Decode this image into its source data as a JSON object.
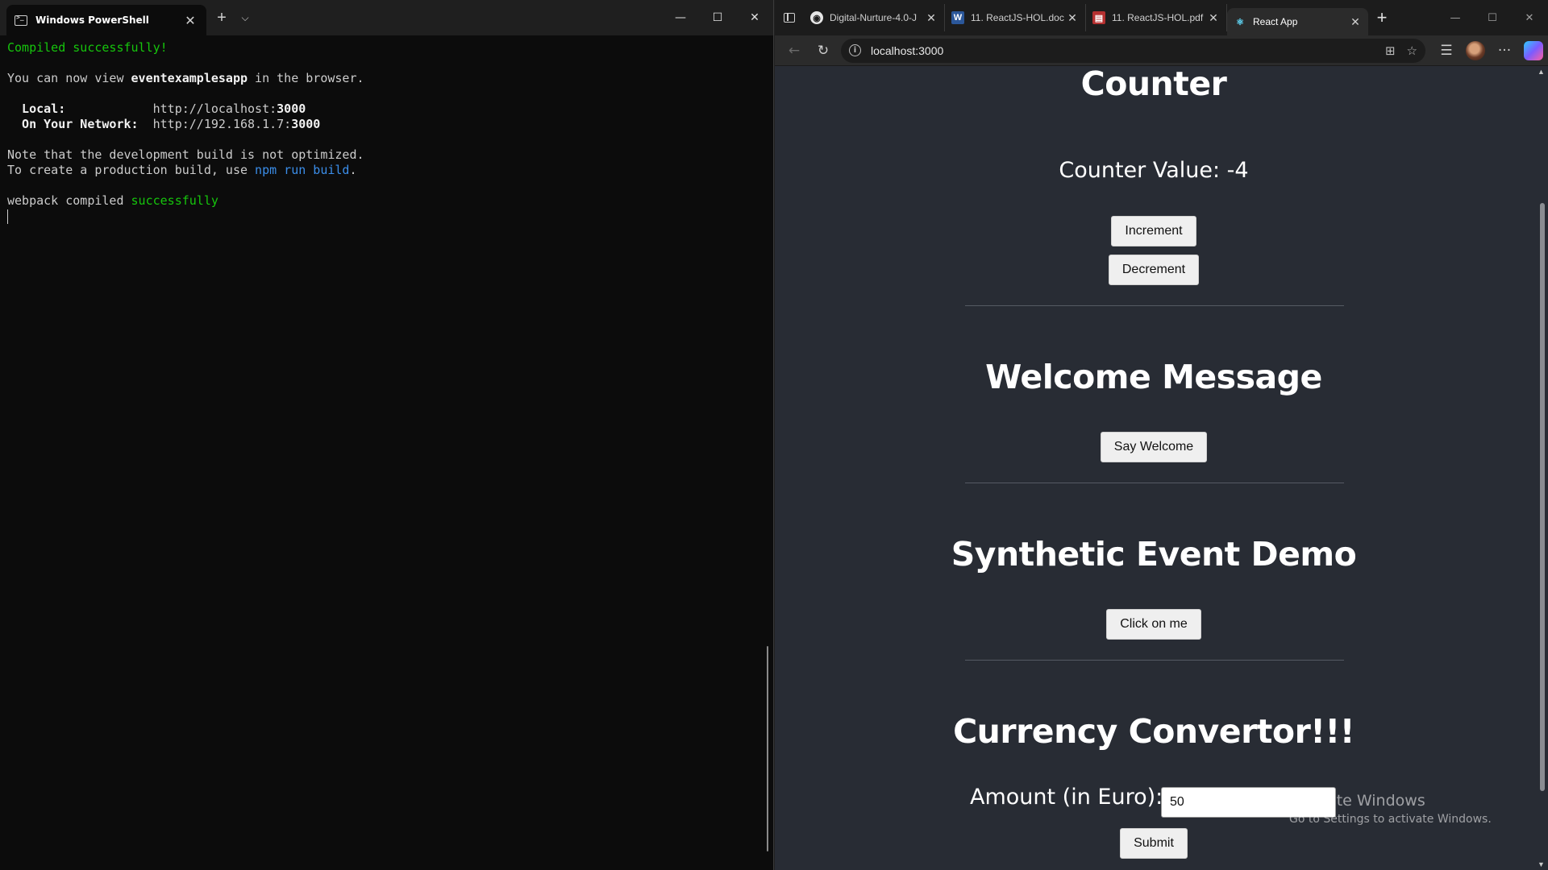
{
  "terminal": {
    "tab_title": "Windows PowerShell",
    "lines": {
      "compiled": "Compiled successfully!",
      "view_prefix": "You can now view ",
      "app_name": "eventexamplesapp",
      "view_suffix": " in the browser.",
      "local_label": "  Local:            ",
      "local_url_prefix": "http://localhost:",
      "local_port": "3000",
      "network_label": "  On Your Network:  ",
      "network_url_prefix": "http://192.168.1.7:",
      "network_port": "3000",
      "note": "Note that the development build is not optimized.",
      "prod_prefix": "To create a production build, use ",
      "prod_cmd": "npm run build",
      "prod_suffix": ".",
      "webpack_prefix": "webpack compiled ",
      "webpack_status": "successfully"
    },
    "colors": {
      "success": "#16c60c",
      "command": "#3b8eea"
    }
  },
  "browser": {
    "tabs": [
      {
        "label": "Digital-Nurture-4.0-J",
        "icon": "github-icon"
      },
      {
        "label": "11. ReactJS-HOL.doc",
        "icon": "word-icon"
      },
      {
        "label": "11. ReactJS-HOL.pdf",
        "icon": "pdf-icon"
      },
      {
        "label": "React App",
        "icon": "react-icon"
      }
    ],
    "address": "localhost:3000",
    "page": {
      "counter": {
        "title": "Counter",
        "value_text": "Counter Value: -4",
        "increment_label": "Increment",
        "decrement_label": "Decrement"
      },
      "welcome": {
        "title": "Welcome Message",
        "button_label": "Say Welcome"
      },
      "synthetic": {
        "title": "Synthetic Event Demo",
        "button_label": "Click on me"
      },
      "currency": {
        "title": "Currency Convertor!!!",
        "amount_label": "Amount (in Euro):",
        "amount_value": "50",
        "submit_label": "Submit"
      }
    },
    "background": "#282c34"
  },
  "watermark": {
    "line1": "Activate Windows",
    "line2": "Go to Settings to activate Windows."
  }
}
